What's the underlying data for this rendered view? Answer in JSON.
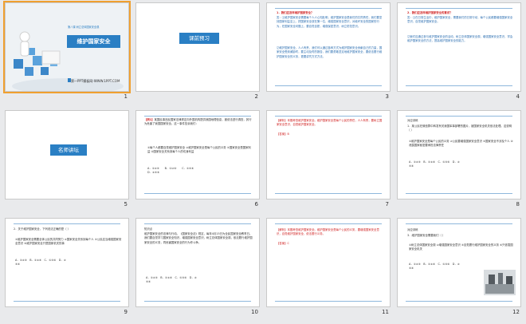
{
  "slides": [
    {
      "num": "1",
      "subtitle": "第八课 树立总体国家安全观",
      "title": "维护国家安全",
      "footer": "第一PPT模板网-WWW.1PPT.COM"
    },
    {
      "num": "2",
      "button": "课前预习"
    },
    {
      "num": "3",
      "q1": "1．我们应怎样维护国家安全？",
      "a1": "答：⑴维护国家安全需要每个人人心知肚明，维护国家安全是我们的共同责任，我们要坚持国家利益至上，把国家安全放在第一位，增强国家安全意识，对破坏安全的国家的行为，在国家安全问题上，要自觉自愿，增强保密意识，树立防范意识。",
      "a2": "⑵维护国家安全，人人有责，我们可以通过各种方式为维护国家安全贡献自己的力量，国家安全受到威胁时，要主动及时的报告，我们要勇敢坚定地维护国家安全，要依法履行维护国家安全的义务，更要讲究方式方法。"
    },
    {
      "num": "4",
      "q2": "2．我们应怎样维护国家安全的意识？",
      "a1": "答：⑴在日常生活中，维护国家安全，需要我们的日常行动，每个公民都要增强国家安全意识，自觉维护国家安全。",
      "a2": "⑵我们应通过参与维护国家安全的活动，树立总体国家安全观，增强国家安全意识，学会维护国家安全的方法，提高维护国家安全的能力。"
    },
    {
      "num": "5",
      "button": "名师讲坛"
    },
    {
      "num": "6",
      "lead": "【例1】",
      "stem": "某国民事违反国家法律规定向外国机构提供我国地理信息，被依法进行调查，其行为危害了我国国家安全。这一事件告诉我们：",
      "opts": "①每个人都要自觉维护国家安全 ②维护国家安全是每个公民的义务 ③国家安全是国家利益 ④国家安全关系到每个人的切身利益",
      "choices": "A．①②③　　B．①②④　　C．①③④　　D．②③④"
    },
    {
      "num": "7",
      "analysis": "【解析】本题考查维护国家安全。维护国家安全是每个公民的责任，人人有责，要树立国家安全意识，自觉维护国家安全。",
      "answer": "【答案】B"
    },
    {
      "num": "8",
      "head": "对应训练",
      "q1": "1．某公民在微信群中转发有关我国军事部署的图片，被国家安全机关依法处理。这说明（  ）",
      "opts": "①维护国家安全是每个公民的义务 ②公民要增强国家安全意识 ③国家安全不涉及个人 ④泄露国家秘密要承担法律责任",
      "choices": "A．①②③　B．①②④　C．①③④　D．②③④"
    },
    {
      "num": "9",
      "q2": "2．关于维护国家安全，下列说法正确的是（  ）",
      "opts": "①维护国家安全需要全体公民的共同努力 ②国家安全关系到每个人 ③公民应当增强国家安全意识 ④维护国家安全只是国家机关的事",
      "choices": "A．①②③　B．①②④　C．①③④　D．②③④"
    },
    {
      "num": "10",
      "head": "知识点",
      "body": "维护国家安全的法律与行动。《国家安全法》规定，每年4月15日为全民国家安全教育日。我们要自觉学习国家安全知识，增强国家安全意识，树立总体国家安全观，依法履行维护国家安全的义务，同危害国家安全的行为作斗争。",
      "choices": "A．①②③　B．①②④　C．①③④　D．②③④"
    },
    {
      "num": "11",
      "analysis": "【解析】本题考查维护国家安全。维护国家安全是每个公民的义务，要增强国家安全意识，自觉维护国家安全，依法履行义务。",
      "answer": "【答案】C"
    },
    {
      "num": "12",
      "head": "对应训练",
      "q3": "3．维护国家安全需要我们（  ）",
      "opts": "①树立总体国家安全观 ②增强国家安全意识 ③自觉履行维护国家安全的义务 ④只依靠国家安全机关",
      "choices": "A．①②③　B．①②④　C．①③④　D．②③④"
    }
  ],
  "colors": {
    "accent": "#2a7fc4",
    "red": "#d02020",
    "selected": "#f0a030"
  }
}
